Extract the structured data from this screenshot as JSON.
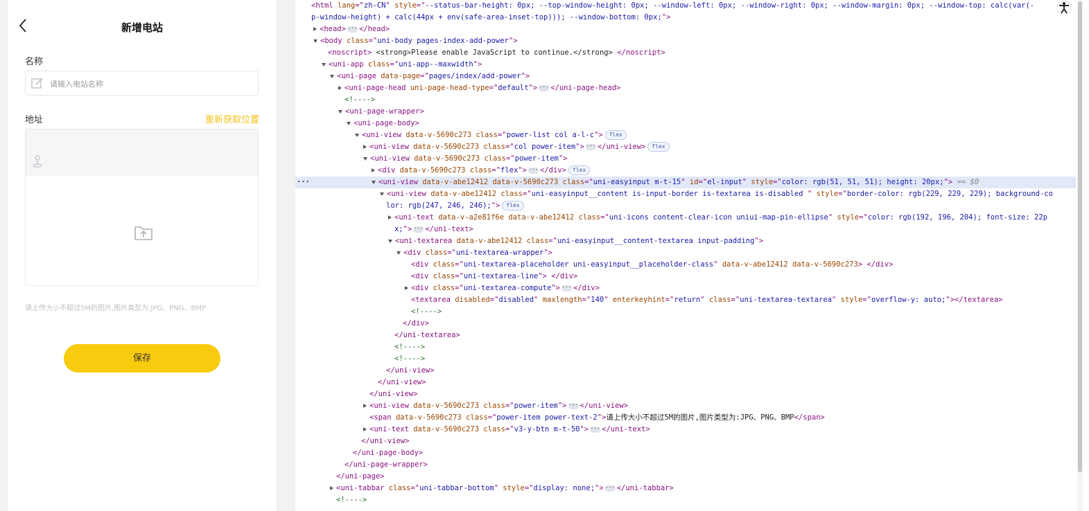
{
  "app": {
    "nav_title": "新增电站",
    "name_label": "名称",
    "name_placeholder": "请输入电站名称",
    "address_label": "地址",
    "relocate_label": "重新获取位置",
    "upload_hint": "请上传大小不超过5M的图片,图片类型为:JPG、PNG、BMP",
    "save_label": "保存",
    "accent_color": "#f8cb0e",
    "link_color": "#f3c21a",
    "icons": [
      "back-arrow-icon",
      "edit-icon",
      "map-pin-icon",
      "upload-folder-icon",
      "accessibility-icon"
    ]
  },
  "devtools": {
    "selected_line": 15,
    "lines": [
      {
        "indent": 0,
        "tri": "none",
        "segs": [
          [
            "tg",
            "<html "
          ],
          [
            "an",
            "lang"
          ],
          [
            "tg",
            "=\""
          ],
          [
            "av",
            "zh-CN"
          ],
          [
            "tg",
            "\" "
          ],
          [
            "an",
            "style"
          ],
          [
            "tg",
            "=\""
          ],
          [
            "av",
            "--status-bar-height: 0px; --top-window-height: 0px; --window-left: 0px; --window-right: 0px; --window-margin: 0px; --window-top: calc(var(-"
          ],
          [
            "tg",
            ""
          ]
        ]
      },
      {
        "indent": 0,
        "tri": "none",
        "segs": [
          [
            "av",
            "p-window-height) + calc(44px + env(safe-area-inset-top))); --window-bottom: 0px;"
          ],
          [
            "tg",
            "\">"
          ]
        ]
      },
      {
        "indent": 1,
        "tri": "closed",
        "segs": [
          [
            "tg",
            "<head>"
          ],
          [
            "ell",
            "···"
          ],
          [
            "tg",
            "</head>"
          ]
        ]
      },
      {
        "indent": 1,
        "tri": "open",
        "segs": [
          [
            "tg",
            "<body "
          ],
          [
            "an",
            "class"
          ],
          [
            "tg",
            "=\""
          ],
          [
            "av",
            "uni-body pages-index-add-power"
          ],
          [
            "tg",
            "\">"
          ]
        ]
      },
      {
        "indent": 2,
        "tri": "none",
        "segs": [
          [
            "tg",
            "<noscript> "
          ],
          [
            "tx",
            "<strong>Please enable JavaScript to continue.</strong> "
          ],
          [
            "tg",
            "</noscript>"
          ]
        ]
      },
      {
        "indent": 2,
        "tri": "open",
        "segs": [
          [
            "tg",
            "<uni-app "
          ],
          [
            "an",
            "class"
          ],
          [
            "tg",
            "=\""
          ],
          [
            "av",
            "uni-app--maxwidth"
          ],
          [
            "tg",
            "\">"
          ]
        ]
      },
      {
        "indent": 3,
        "tri": "open",
        "segs": [
          [
            "tg",
            "<uni-page "
          ],
          [
            "an",
            "data-page"
          ],
          [
            "tg",
            "=\""
          ],
          [
            "av",
            "pages/index/add-power"
          ],
          [
            "tg",
            "\">"
          ]
        ]
      },
      {
        "indent": 4,
        "tri": "closed",
        "segs": [
          [
            "tg",
            "<uni-page-head "
          ],
          [
            "an",
            "uni-page-head-type"
          ],
          [
            "tg",
            "=\""
          ],
          [
            "av",
            "default"
          ],
          [
            "tg",
            "\">"
          ],
          [
            "ell",
            "···"
          ],
          [
            "tg",
            "</uni-page-head>"
          ]
        ]
      },
      {
        "indent": 4,
        "tri": "none",
        "segs": [
          [
            "cm",
            "<!---->"
          ]
        ]
      },
      {
        "indent": 4,
        "tri": "open",
        "segs": [
          [
            "tg",
            "<uni-page-wrapper>"
          ]
        ]
      },
      {
        "indent": 5,
        "tri": "open",
        "segs": [
          [
            "tg",
            "<uni-page-body>"
          ]
        ]
      },
      {
        "indent": 6,
        "tri": "open",
        "segs": [
          [
            "tg",
            "<uni-view "
          ],
          [
            "an",
            "data-v-5690c273 class"
          ],
          [
            "tg",
            "=\""
          ],
          [
            "av",
            "power-list col a-l-c"
          ],
          [
            "tg",
            "\">"
          ],
          [
            "badge",
            "flex"
          ]
        ]
      },
      {
        "indent": 7,
        "tri": "closed",
        "segs": [
          [
            "tg",
            "<uni-view "
          ],
          [
            "an",
            "data-v-5690c273 class"
          ],
          [
            "tg",
            "=\""
          ],
          [
            "av",
            "col power-item"
          ],
          [
            "tg",
            "\">"
          ],
          [
            "ell",
            "···"
          ],
          [
            "tg",
            "</uni-view>"
          ],
          [
            "badge",
            "flex"
          ]
        ]
      },
      {
        "indent": 7,
        "tri": "open",
        "segs": [
          [
            "tg",
            "<uni-view "
          ],
          [
            "an",
            "data-v-5690c273 class"
          ],
          [
            "tg",
            "=\""
          ],
          [
            "av",
            "power-item"
          ],
          [
            "tg",
            "\">"
          ]
        ]
      },
      {
        "indent": 8,
        "tri": "closed",
        "segs": [
          [
            "tg",
            "<div "
          ],
          [
            "an",
            "data-v-5690c273 class"
          ],
          [
            "tg",
            "=\""
          ],
          [
            "av",
            "flex"
          ],
          [
            "tg",
            "\">"
          ],
          [
            "ell",
            "···"
          ],
          [
            "tg",
            "</div>"
          ],
          [
            "badge",
            "flex"
          ]
        ]
      },
      {
        "indent": 8,
        "tri": "open",
        "segs": [
          [
            "tg",
            "<uni-view "
          ],
          [
            "an",
            "data-v-abe12412 data-v-5690c273 class"
          ],
          [
            "tg",
            "=\""
          ],
          [
            "av",
            "uni-easyinput m-t-15"
          ],
          [
            "tg",
            "\" "
          ],
          [
            "an",
            "id"
          ],
          [
            "tg",
            "=\""
          ],
          [
            "av",
            "el-input"
          ],
          [
            "tg",
            "\" "
          ],
          [
            "an",
            "style"
          ],
          [
            "tg",
            "=\""
          ],
          [
            "av",
            "color: rgb(51, 51, 51); height: 20px;"
          ],
          [
            "tg",
            "\">"
          ],
          [
            "eq",
            " == $0"
          ]
        ]
      },
      {
        "indent": 9,
        "tri": "open",
        "segs": [
          [
            "tg",
            "<uni-view "
          ],
          [
            "an",
            "data-v-abe12412 class"
          ],
          [
            "tg",
            "=\""
          ],
          [
            "av",
            "uni-easyinput__content is-input-border is-textarea is-disabled "
          ],
          [
            "tg",
            "\" "
          ],
          [
            "an",
            "style"
          ],
          [
            "tg",
            "=\""
          ],
          [
            "av",
            "border-color: rgb(229, 229, 229); background-co"
          ]
        ]
      },
      {
        "indent": 9,
        "tri": "none",
        "segs": [
          [
            "av",
            "lor: rgb(247, 246, 246);"
          ],
          [
            "tg",
            "\">"
          ],
          [
            "badge",
            "flex"
          ]
        ]
      },
      {
        "indent": 10,
        "tri": "closed",
        "segs": [
          [
            "tg",
            "<uni-text "
          ],
          [
            "an",
            "data-v-a2e81f6e data-v-abe12412 class"
          ],
          [
            "tg",
            "=\""
          ],
          [
            "av",
            "uni-icons content-clear-icon uniui-map-pin-ellipse"
          ],
          [
            "tg",
            "\" "
          ],
          [
            "an",
            "style"
          ],
          [
            "tg",
            "=\""
          ],
          [
            "av",
            "color: rgb(192, 196, 204); font-size: 22p"
          ]
        ]
      },
      {
        "indent": 10,
        "tri": "none",
        "segs": [
          [
            "av",
            "x;"
          ],
          [
            "tg",
            "\">"
          ],
          [
            "ell",
            "···"
          ],
          [
            "tg",
            "</uni-text>"
          ]
        ]
      },
      {
        "indent": 10,
        "tri": "open",
        "segs": [
          [
            "tg",
            "<uni-textarea "
          ],
          [
            "an",
            "data-v-abe12412 class"
          ],
          [
            "tg",
            "=\""
          ],
          [
            "av",
            "uni-easyinput__content-textarea input-padding"
          ],
          [
            "tg",
            "\">"
          ]
        ]
      },
      {
        "indent": 11,
        "tri": "open",
        "segs": [
          [
            "tg",
            "<div "
          ],
          [
            "an",
            "class"
          ],
          [
            "tg",
            "=\""
          ],
          [
            "av",
            "uni-textarea-wrapper"
          ],
          [
            "tg",
            "\">"
          ]
        ]
      },
      {
        "indent": 12,
        "tri": "none",
        "segs": [
          [
            "tg",
            "<div "
          ],
          [
            "an",
            "class"
          ],
          [
            "tg",
            "=\""
          ],
          [
            "av",
            "uni-textarea-placeholder uni-easyinput__placeholder-class"
          ],
          [
            "tg",
            "\" "
          ],
          [
            "an",
            "data-v-abe12412 data-v-5690c273"
          ],
          [
            "tg",
            "> </div>"
          ]
        ]
      },
      {
        "indent": 12,
        "tri": "none",
        "segs": [
          [
            "tg",
            "<div "
          ],
          [
            "an",
            "class"
          ],
          [
            "tg",
            "=\""
          ],
          [
            "av",
            "uni-textarea-line"
          ],
          [
            "tg",
            "\"> </div>"
          ]
        ]
      },
      {
        "indent": 12,
        "tri": "closed",
        "segs": [
          [
            "tg",
            "<div "
          ],
          [
            "an",
            "class"
          ],
          [
            "tg",
            "=\""
          ],
          [
            "av",
            "uni-textarea-compute"
          ],
          [
            "tg",
            "\">"
          ],
          [
            "ell",
            "···"
          ],
          [
            "tg",
            "</div>"
          ]
        ]
      },
      {
        "indent": 12,
        "tri": "none",
        "segs": [
          [
            "tg",
            "<textarea "
          ],
          [
            "an",
            "disabled"
          ],
          [
            "tg",
            "=\""
          ],
          [
            "av",
            "disabled"
          ],
          [
            "tg",
            "\" "
          ],
          [
            "an",
            "maxlength"
          ],
          [
            "tg",
            "=\""
          ],
          [
            "av",
            "140"
          ],
          [
            "tg",
            "\" "
          ],
          [
            "an",
            "enterkeyhint"
          ],
          [
            "tg",
            "=\""
          ],
          [
            "av",
            "return"
          ],
          [
            "tg",
            "\" "
          ],
          [
            "an",
            "class"
          ],
          [
            "tg",
            "=\""
          ],
          [
            "av",
            "uni-textarea-textarea"
          ],
          [
            "tg",
            "\" "
          ],
          [
            "an",
            "style"
          ],
          [
            "tg",
            "=\""
          ],
          [
            "av",
            "overflow-y: auto;"
          ],
          [
            "tg",
            "\"></textarea>"
          ]
        ]
      },
      {
        "indent": 12,
        "tri": "none",
        "segs": [
          [
            "cm",
            "<!---->"
          ]
        ]
      },
      {
        "indent": 11,
        "tri": "none",
        "segs": [
          [
            "tg",
            "</div>"
          ]
        ]
      },
      {
        "indent": 10,
        "tri": "none",
        "segs": [
          [
            "tg",
            "</uni-textarea>"
          ]
        ]
      },
      {
        "indent": 10,
        "tri": "none",
        "segs": [
          [
            "cm",
            "<!---->"
          ]
        ]
      },
      {
        "indent": 10,
        "tri": "none",
        "segs": [
          [
            "cm",
            "<!---->"
          ]
        ]
      },
      {
        "indent": 9,
        "tri": "none",
        "segs": [
          [
            "tg",
            "</uni-view>"
          ]
        ]
      },
      {
        "indent": 8,
        "tri": "none",
        "segs": [
          [
            "tg",
            "</uni-view>"
          ]
        ]
      },
      {
        "indent": 7,
        "tri": "none",
        "segs": [
          [
            "tg",
            "</uni-view>"
          ]
        ]
      },
      {
        "indent": 7,
        "tri": "closed",
        "segs": [
          [
            "tg",
            "<uni-view "
          ],
          [
            "an",
            "data-v-5690c273 class"
          ],
          [
            "tg",
            "=\""
          ],
          [
            "av",
            "power-item"
          ],
          [
            "tg",
            "\">"
          ],
          [
            "ell",
            "···"
          ],
          [
            "tg",
            "</uni-view>"
          ]
        ]
      },
      {
        "indent": 7,
        "tri": "none",
        "segs": [
          [
            "tg",
            "<span "
          ],
          [
            "an",
            "data-v-5690c273 class"
          ],
          [
            "tg",
            "=\""
          ],
          [
            "av",
            "power-item power-text-2"
          ],
          [
            "tg",
            "\">"
          ],
          [
            "tx",
            "请上传大小不超过5M的图片,图片类型为:JPG、PNG、BMP"
          ],
          [
            "tg",
            "</span>"
          ]
        ]
      },
      {
        "indent": 7,
        "tri": "closed",
        "segs": [
          [
            "tg",
            "<uni-text "
          ],
          [
            "an",
            "data-v-5690c273 class"
          ],
          [
            "tg",
            "=\""
          ],
          [
            "av",
            "v3-y-btn m-t-50"
          ],
          [
            "tg",
            "\">"
          ],
          [
            "ell",
            "···"
          ],
          [
            "tg",
            "</uni-text>"
          ]
        ]
      },
      {
        "indent": 6,
        "tri": "none",
        "segs": [
          [
            "tg",
            "</uni-view>"
          ]
        ]
      },
      {
        "indent": 5,
        "tri": "none",
        "segs": [
          [
            "tg",
            "</uni-page-body>"
          ]
        ]
      },
      {
        "indent": 4,
        "tri": "none",
        "segs": [
          [
            "tg",
            "</uni-page-wrapper>"
          ]
        ]
      },
      {
        "indent": 3,
        "tri": "none",
        "segs": [
          [
            "tg",
            "</uni-page>"
          ]
        ]
      },
      {
        "indent": 3,
        "tri": "closed",
        "segs": [
          [
            "tg",
            "<uni-tabbar "
          ],
          [
            "an",
            "class"
          ],
          [
            "tg",
            "=\""
          ],
          [
            "av",
            "uni-tabbar-bottom"
          ],
          [
            "tg",
            "\" "
          ],
          [
            "an",
            "style"
          ],
          [
            "tg",
            "=\""
          ],
          [
            "av",
            "display: none;"
          ],
          [
            "tg",
            "\">"
          ],
          [
            "ell",
            "···"
          ],
          [
            "tg",
            "</uni-tabbar>"
          ]
        ]
      },
      {
        "indent": 3,
        "tri": "none",
        "segs": [
          [
            "cm",
            "<!---->"
          ]
        ]
      }
    ]
  }
}
